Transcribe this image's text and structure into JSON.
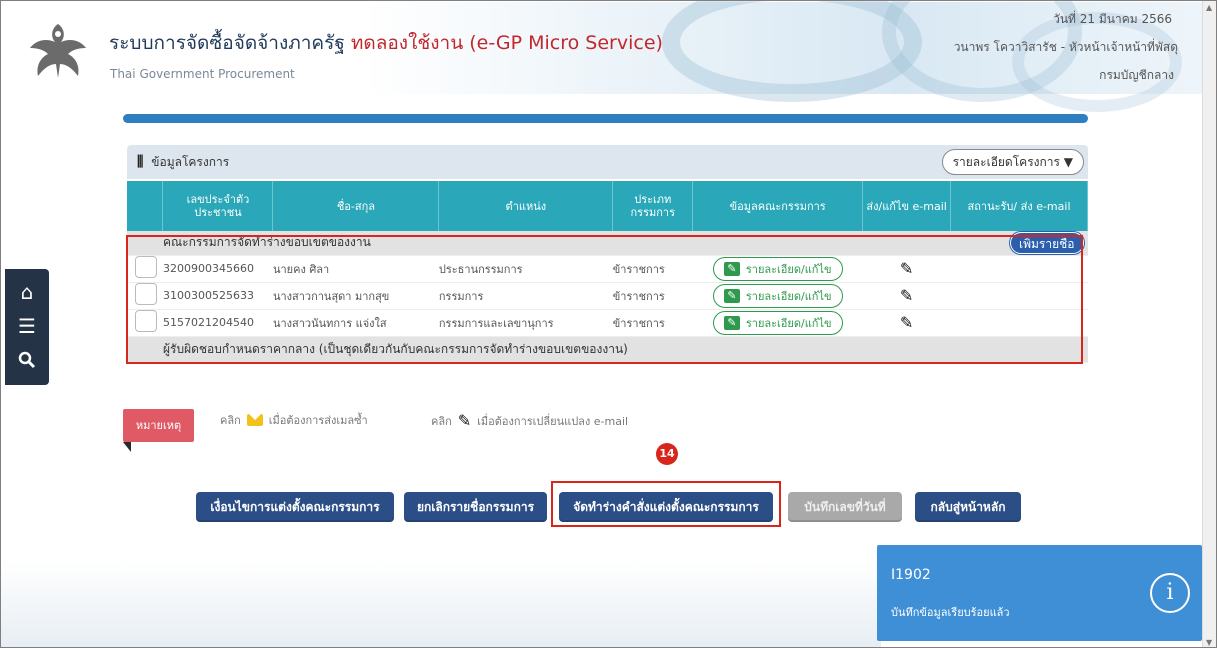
{
  "header": {
    "title_main": "ระบบการจัดซื้อจัดจ้างภาครัฐ",
    "title_trial": "ทดลองใช้งาน (e-GP Micro Service)",
    "subtitle": "Thai Government Procurement",
    "date": "วันที่ 21 มีนาคม 2566",
    "user": "วนาพร โควาวิสารัช - หัวหน้าเจ้าหน้าที่พัสดุ",
    "department": "กรมบัญชีกลาง"
  },
  "panel": {
    "title": "ข้อมูลโครงการ",
    "project_detail_button": "รายละเอียดโครงการ ▼"
  },
  "table": {
    "headers": [
      "",
      "เลขประจำตัว ประชาชน",
      "ชื่อ-สกุล",
      "ตำแหน่ง",
      "ประเภท กรรมการ",
      "ข้อมูลคณะกรรมการ",
      "ส่ง/แก้ไข e-mail",
      "สถานะรับ/ ส่ง e-mail"
    ],
    "group1": "คณะกรรมการจัดทำร่างขอบเขตของงาน",
    "add_button": "เพิ่มรายชื่อ",
    "rows": [
      {
        "id": "3200900345660",
        "name": "นายคง ศิลา",
        "position": "ประธานกรรมการ",
        "type": "ข้าราชการ",
        "action": "รายละเอียด/แก้ไข"
      },
      {
        "id": "3100300525633",
        "name": "นางสาวกานสุดา มากสุข",
        "position": "กรรมการ",
        "type": "ข้าราชการ",
        "action": "รายละเอียด/แก้ไข"
      },
      {
        "id": "5157021204540",
        "name": "นางสาวนันทการ แจ่งใส",
        "position": "กรรมการและเลขานุการ",
        "type": "ข้าราชการ",
        "action": "รายละเอียด/แก้ไข"
      }
    ],
    "group2": "ผู้รับผิดชอบกำหนดราคากลาง (เป็นชุดเดียวกันกับคณะกรรมการจัดทำร่างขอบเขตของงาน)"
  },
  "note": {
    "tag": "หมายเหตุ",
    "click1": "คลิก",
    "desc1": "เมื่อต้องการส่งเมลซ้ำ",
    "click2": "คลิก",
    "desc2": "เมื่อต้องการเปลี่ยนแปลง e-mail"
  },
  "step_badge": "14",
  "buttons": {
    "conditions": "เงื่อนไขการแต่งตั้งคณะกรรมการ",
    "cancel_list": "ยกเลิกรายชื่อกรรมการ",
    "draft_order": "จัดทำร่างคำสั่งแต่งตั้งคณะกรรมการ",
    "save_next": "บันทึกเลขที่วันที่",
    "back_home": "กลับสู่หน้าหลัก"
  },
  "toast": {
    "code": "I1902",
    "message": "บันทึกข้อมูลเรียบร้อยแล้ว"
  },
  "colors": {
    "header_blue": "#2d7fc1",
    "table_header": "#2aa7b8",
    "button_blue": "#2b4e86",
    "highlight_red": "#d9261c",
    "edit_green": "#2e9a4e",
    "toast_blue": "#3f8fd7"
  }
}
